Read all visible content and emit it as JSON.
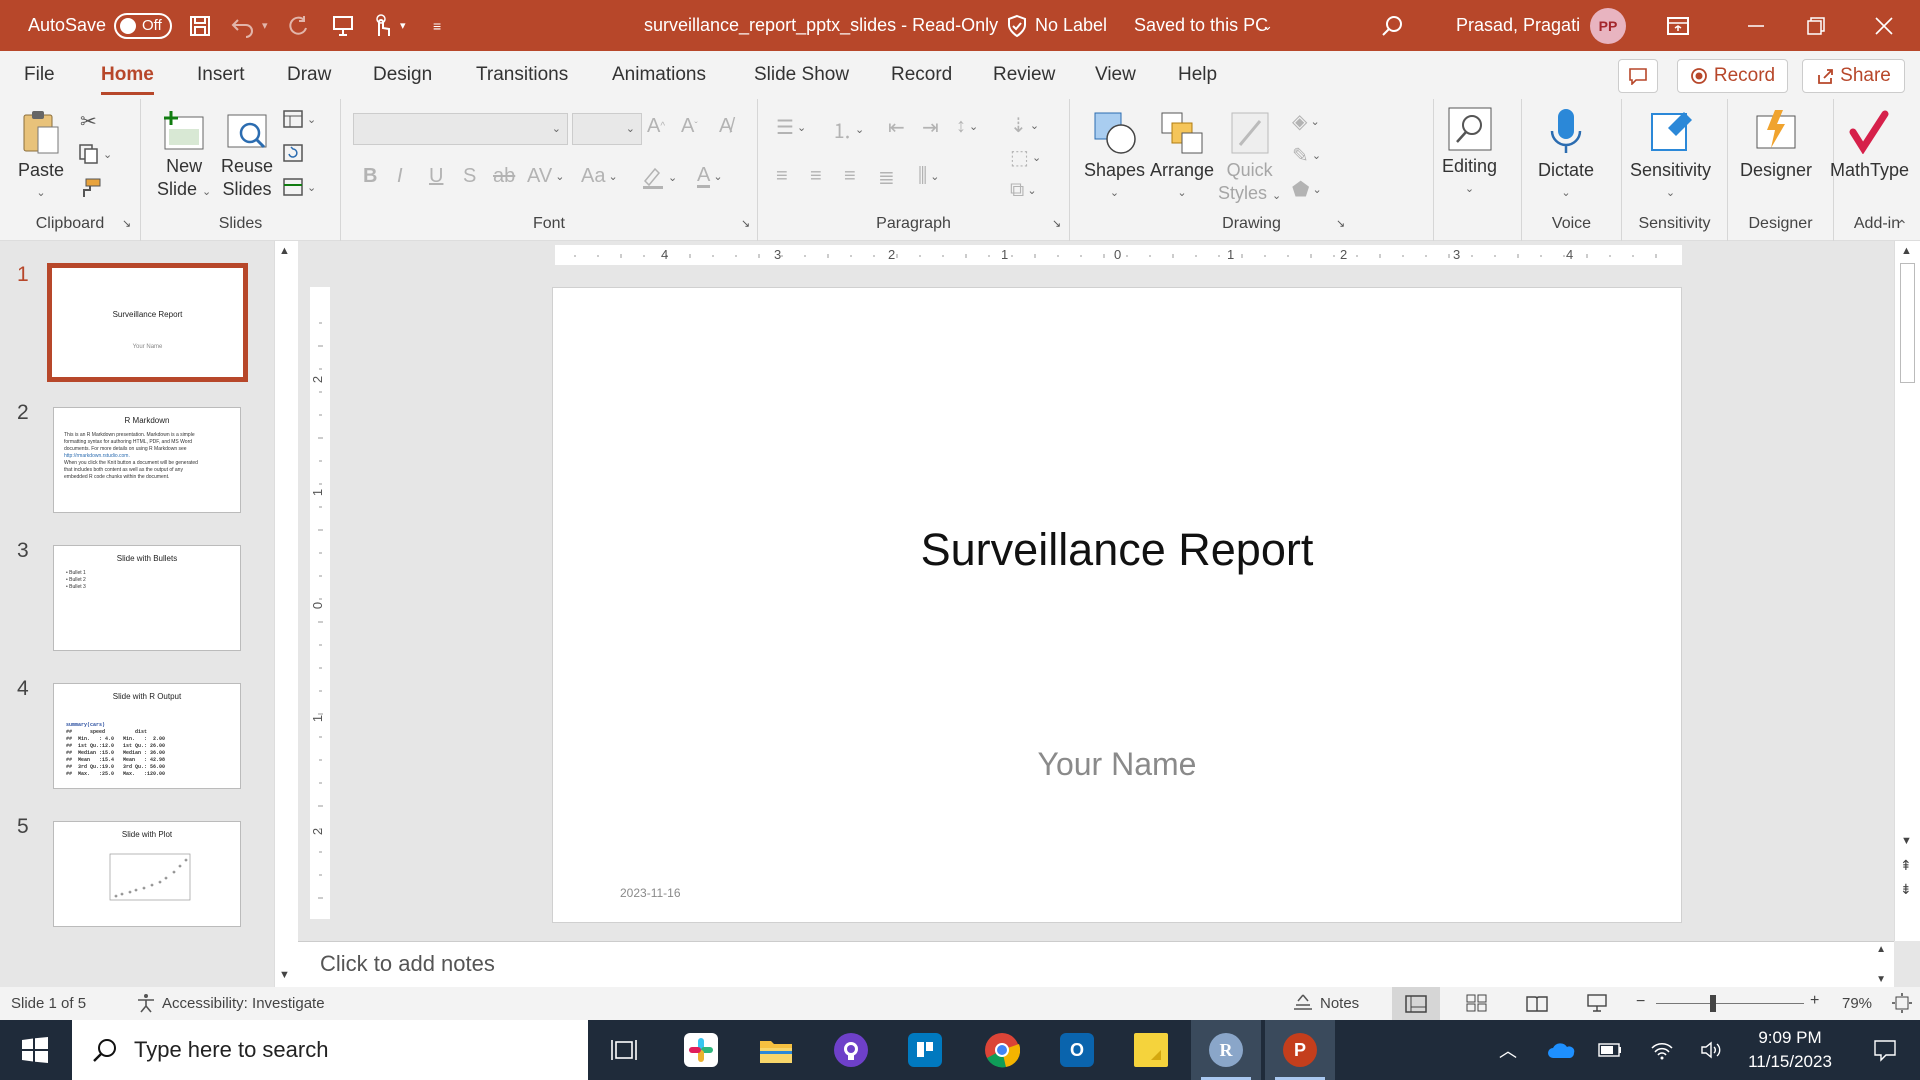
{
  "titlebar": {
    "autosave_label": "AutoSave",
    "autosave_state": "Off",
    "doc_title": "surveillance_report_pptx_slides  -  Read-Only",
    "label_status": "No Label",
    "save_status": "Saved to this PC",
    "user_name": "Prasad, Pragati",
    "user_initials": "PP"
  },
  "menu": {
    "tabs": [
      "File",
      "Home",
      "Insert",
      "Draw",
      "Design",
      "Transitions",
      "Animations",
      "Slide Show",
      "Record",
      "Review",
      "View",
      "Help"
    ],
    "active": "Home",
    "record_label": "Record",
    "share_label": "Share"
  },
  "ribbon": {
    "clipboard": {
      "paste": "Paste",
      "group": "Clipboard"
    },
    "slides": {
      "new_slide_1": "New",
      "new_slide_2": "Slide",
      "reuse_1": "Reuse",
      "reuse_2": "Slides",
      "group": "Slides"
    },
    "font": {
      "group": "Font"
    },
    "paragraph": {
      "group": "Paragraph"
    },
    "drawing": {
      "shapes": "Shapes",
      "arrange": "Arrange",
      "quick_styles_1": "Quick",
      "quick_styles_2": "Styles",
      "group": "Drawing"
    },
    "editing": {
      "label": "Editing"
    },
    "voice": {
      "dictate": "Dictate",
      "group": "Voice"
    },
    "sensitivity": {
      "label": "Sensitivity",
      "group": "Sensitivity"
    },
    "designer": {
      "label": "Designer",
      "group": "Designer"
    },
    "addin": {
      "mathtype": "MathType",
      "group": "Add-in"
    }
  },
  "thumbnails": [
    {
      "num": "1",
      "title": "Surveillance Report",
      "subtitle": "Your Name"
    },
    {
      "num": "2",
      "title": "R Markdown",
      "lines": [
        "This is an R Markdown presentation. Markdown is a simple",
        "formatting syntax for authoring HTML, PDF, and MS Word",
        "documents. For more details on using R Markdown see",
        "http://rmarkdown.rstudio.com.",
        "When you click the Knit button a document will be generated",
        "that includes both content as well as the output of any",
        "embedded R code chunks within the document."
      ]
    },
    {
      "num": "3",
      "title": "Slide with Bullets",
      "lines": [
        "•  Bullet 1",
        "•  Bullet 2",
        "•  Bullet 3"
      ]
    },
    {
      "num": "4",
      "title": "Slide with R Output",
      "lines": [
        "summary(cars)",
        "##      speed          dist",
        "##  Min.   : 4.0   Min.   :  2.00",
        "##  1st Qu.:12.0   1st Qu.: 26.00",
        "##  Median :15.0   Median : 36.00",
        "##  Mean   :15.4   Mean   : 42.98",
        "##  3rd Qu.:19.0   3rd Qu.: 56.00",
        "##  Max.   :25.0   Max.   :120.00"
      ]
    },
    {
      "num": "5",
      "title": "Slide with Plot"
    }
  ],
  "ruler": {
    "h": [
      "4",
      "3",
      "2",
      "1",
      "0",
      "1",
      "2",
      "3",
      "4"
    ],
    "v": [
      "2",
      "1",
      "0",
      "1",
      "2"
    ]
  },
  "slide": {
    "title": "Surveillance Report",
    "subtitle": "Your Name",
    "date": "2023-11-16"
  },
  "notes": {
    "placeholder": "Click to add notes"
  },
  "status": {
    "slide_info": "Slide 1 of 5",
    "accessibility": "Accessibility: Investigate",
    "notes": "Notes",
    "zoom": "79%"
  },
  "taskbar": {
    "search_placeholder": "Type here to search",
    "time": "9:09 PM",
    "date": "11/15/2023"
  },
  "colors": {
    "accent": "#b7472a",
    "taskbar": "#1f2b3a"
  }
}
